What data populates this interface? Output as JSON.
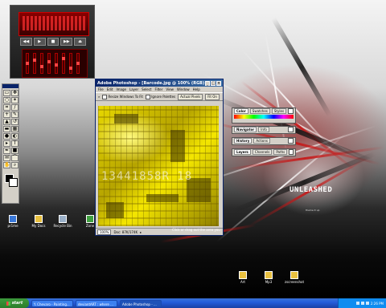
{
  "photoshop": {
    "title": "Adobe Photoshop - [Barcode.jpg @ 100% (RGB)]",
    "menu": [
      "File",
      "Edit",
      "Image",
      "Layer",
      "Select",
      "Filter",
      "View",
      "Window",
      "Help"
    ],
    "options": {
      "resize_windows": "Resize Windows To Fit",
      "ignore_palettes": "Ignore Palettes",
      "actual_pixels": "Actual Pixels",
      "fit_on_screen": "Fit On"
    },
    "canvas_overlay_text": "13441858R 18",
    "status": {
      "zoom": "100%",
      "doc": "Doc: 87K/174K"
    }
  },
  "status_hint": "Click or drag out the area you",
  "palettes": [
    {
      "tabs": [
        "Color",
        "Swatches",
        "Styles"
      ]
    },
    {
      "tabs": [
        "Navigator",
        "Info"
      ]
    },
    {
      "tabs": [
        "History",
        "Actions"
      ]
    },
    {
      "tabs": [
        "Layers",
        "Channels",
        "Paths"
      ]
    }
  ],
  "desktop_icons": {
    "prime": "pr1me",
    "mydocs": "My Docs",
    "recycle": "Recycle Bin",
    "zone": "Zone",
    "art": "Art",
    "mp3": "Mp3",
    "screenshot": "zscreenshot"
  },
  "logo": {
    "text": "UNLEASHED",
    "sub": "theme it up"
  },
  "taskbar": {
    "start": "start",
    "tasks": [
      "Y. Chevaro - Painting...",
      "deviantART : where ...",
      "Adobe Photoshop - ..."
    ],
    "clock": "2:26 PM"
  },
  "player": {
    "controls": [
      "◀◀",
      "▶",
      "■",
      "▶▶",
      "⏏"
    ]
  }
}
